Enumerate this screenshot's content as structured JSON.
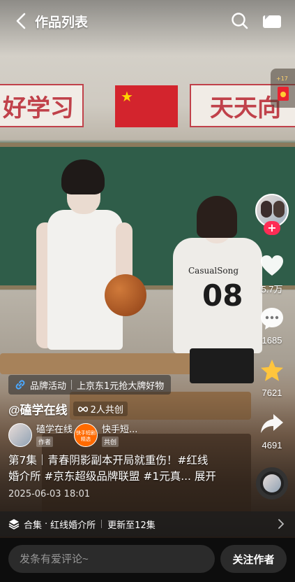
{
  "header": {
    "title": "作品列表"
  },
  "scene": {
    "banner_left": "好学习",
    "banner_right": "天天向",
    "jersey_number": "08",
    "jersey_text": "CasualSong"
  },
  "red_packet": {
    "label": "+17"
  },
  "right_rail": {
    "likes": "5.7万",
    "comments": "1685",
    "favorites": "7621",
    "shares": "4691"
  },
  "brand": {
    "label": "品牌活动",
    "promo": "上京东1元抢大牌好物"
  },
  "author": {
    "name": "@磕学在线",
    "cocreate": "2人共创"
  },
  "creators": [
    {
      "name": "磕学在线",
      "role": "作者"
    },
    {
      "name": "快手短...",
      "role": "共创",
      "badge": "快手短剧精选"
    }
  ],
  "description": {
    "line1": "第7集｜青春阴影副本开局就重伤！#红线",
    "line2": "婚介所 #京东超级品牌联盟 #1元真...",
    "expand": "展开",
    "date": "2025-06-03 18:01"
  },
  "collection": {
    "label": "合集",
    "name": "红线婚介所",
    "updated": "更新至12集"
  },
  "bottom": {
    "comment_placeholder": "发条有爱评论~",
    "follow_label": "关注作者"
  },
  "colors": {
    "accent": "#fe2c55",
    "favorite": "#ffc53d"
  }
}
